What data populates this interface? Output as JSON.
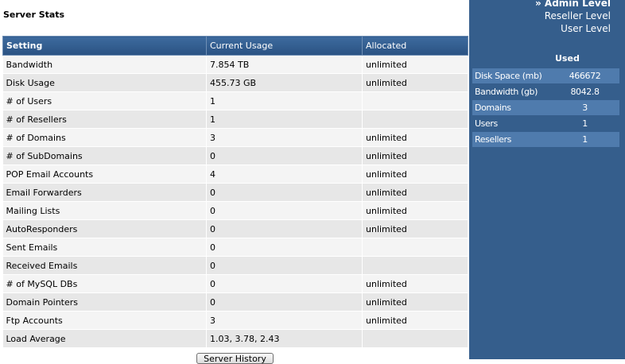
{
  "main": {
    "title": "Server Stats",
    "columns": [
      "Setting",
      "Current Usage",
      "Allocated"
    ],
    "rows": [
      {
        "setting": "Bandwidth",
        "usage": "7.854 TB",
        "allocated": "unlimited"
      },
      {
        "setting": "Disk Usage",
        "usage": "455.73 GB",
        "allocated": "unlimited"
      },
      {
        "setting": "# of Users",
        "usage": "1",
        "allocated": ""
      },
      {
        "setting": "# of Resellers",
        "usage": "1",
        "allocated": ""
      },
      {
        "setting": "# of Domains",
        "usage": "3",
        "allocated": "unlimited"
      },
      {
        "setting": "# of SubDomains",
        "usage": "0",
        "allocated": "unlimited"
      },
      {
        "setting": "POP Email Accounts",
        "usage": "4",
        "allocated": "unlimited"
      },
      {
        "setting": "Email Forwarders",
        "usage": "0",
        "allocated": "unlimited"
      },
      {
        "setting": "Mailing Lists",
        "usage": "0",
        "allocated": "unlimited"
      },
      {
        "setting": "AutoResponders",
        "usage": "0",
        "allocated": "unlimited"
      },
      {
        "setting": "Sent Emails",
        "usage": "0",
        "allocated": ""
      },
      {
        "setting": "Received Emails",
        "usage": "0",
        "allocated": ""
      },
      {
        "setting": "# of MySQL DBs",
        "usage": "0",
        "allocated": "unlimited"
      },
      {
        "setting": "Domain Pointers",
        "usage": "0",
        "allocated": "unlimited"
      },
      {
        "setting": "Ftp Accounts",
        "usage": "3",
        "allocated": "unlimited"
      },
      {
        "setting": "Load Average",
        "usage": "1.03, 3.78, 2.43",
        "allocated": ""
      }
    ],
    "history_button": "Server History"
  },
  "sidebar": {
    "levels": [
      "» Admin Level",
      "Reseller Level",
      "User Level"
    ],
    "used_heading": "Used",
    "used": [
      {
        "label": "Disk Space (mb)",
        "value": "466672"
      },
      {
        "label": "Bandwidth (gb)",
        "value": "8042.8"
      },
      {
        "label": "Domains",
        "value": "3"
      },
      {
        "label": "Users",
        "value": "1"
      },
      {
        "label": "Resellers",
        "value": "1"
      }
    ]
  },
  "colors": {
    "sidebar_bg": "#355e8c",
    "header_bg": "#2a5282",
    "row_odd": "#f4f4f4",
    "row_even": "#e7e7e7"
  }
}
